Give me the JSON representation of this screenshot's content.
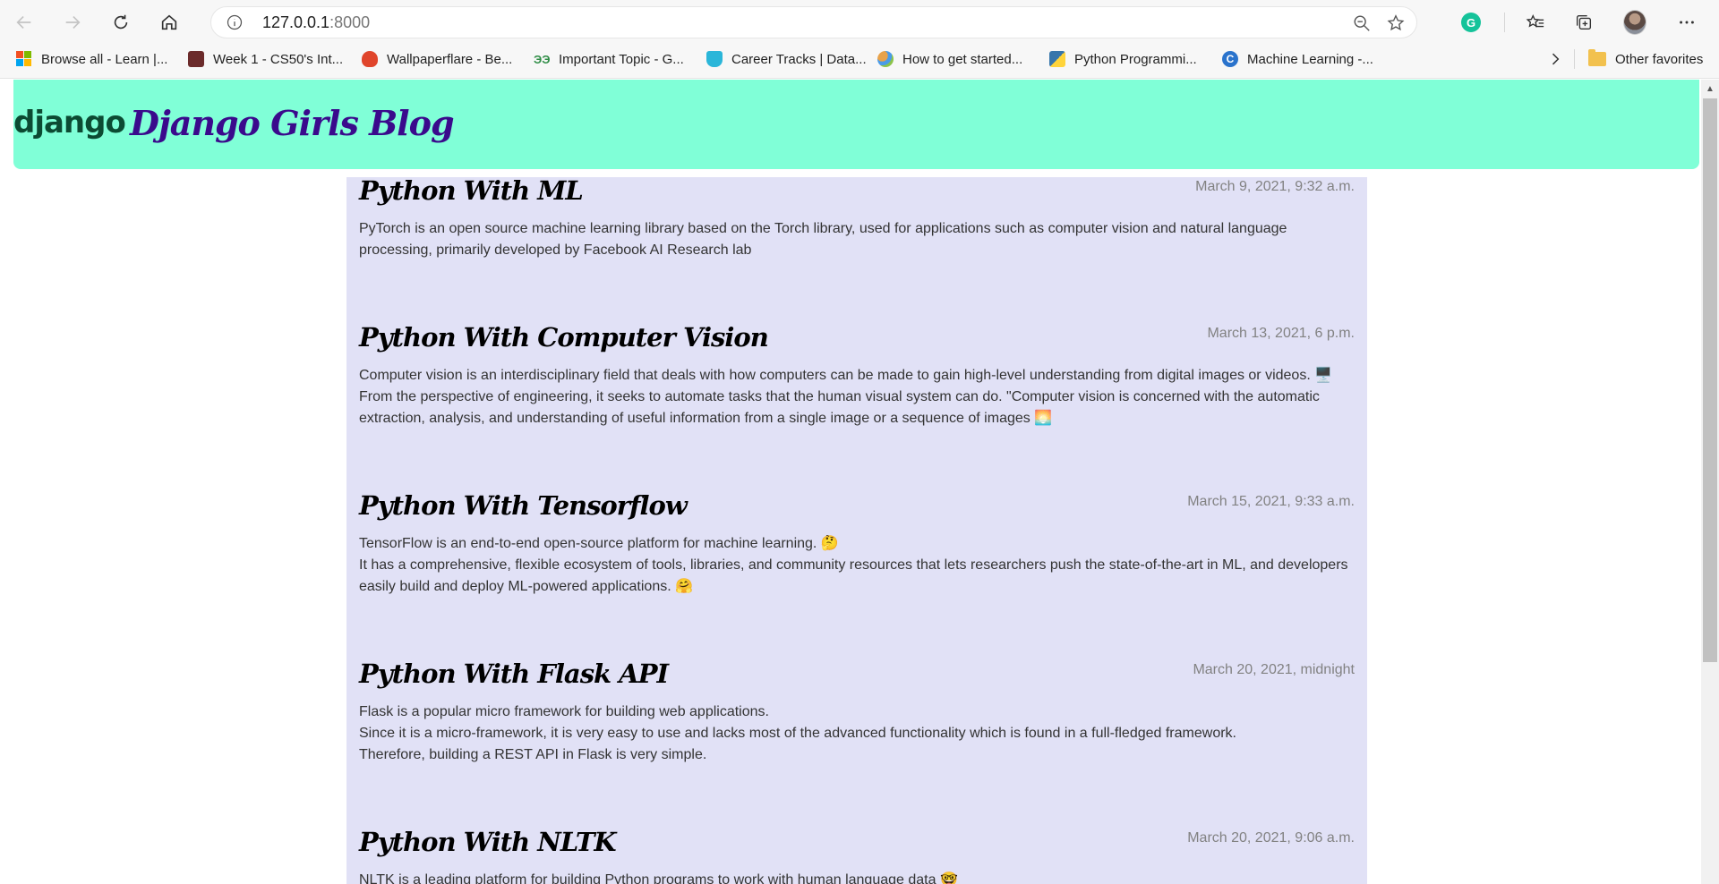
{
  "browser": {
    "url_host": "127.0.0.1",
    "url_port": ":8000",
    "bookmarks": [
      {
        "label": "Browse all - Learn |...",
        "icon": "microsoft-icon"
      },
      {
        "label": "Week 1 - CS50's Int...",
        "icon": "harvard-icon",
        "color": "#6b2b2b"
      },
      {
        "label": "Wallpaperflare - Be...",
        "icon": "flame-icon",
        "color": "#e0452b"
      },
      {
        "label": "Important Topic - G...",
        "icon": "gfg-icon",
        "color": "#2f8d46"
      },
      {
        "label": "Career Tracks | Data...",
        "icon": "datacamp-icon",
        "color": "#03ef62"
      },
      {
        "label": "How to get started...",
        "icon": "kaggle-icon",
        "color": "#e8a24a"
      },
      {
        "label": "Python Programmi...",
        "icon": "python-icon",
        "color": "#3776ab"
      },
      {
        "label": "Machine Learning -...",
        "icon": "coursera-icon",
        "color": "#2a73cc"
      }
    ],
    "other_favorites": "Other favorites",
    "grammarly_letter": "G"
  },
  "header": {
    "logo": "django",
    "title": "Django Girls Blog"
  },
  "posts": [
    {
      "title": "Python With ML",
      "date": "March 9, 2021, 9:32 a.m.",
      "lines": [
        "PyTorch is an open source machine learning library based on the Torch library, used for applications such as computer vision and natural language processing, primarily developed by Facebook AI Research lab"
      ]
    },
    {
      "title": "Python With Computer Vision",
      "date": "March 13, 2021, 6 p.m.",
      "lines": [
        "Computer vision is an interdisciplinary field that deals with how computers can be made to gain high-level understanding from digital images or videos. 🖥️ From the perspective of engineering, it seeks to automate tasks that the human visual system can do. \"Computer vision is concerned with the automatic extraction, analysis, and understanding of useful information from a single image or a sequence of images 🌅"
      ]
    },
    {
      "title": "Python With Tensorflow",
      "date": "March 15, 2021, 9:33 a.m.",
      "lines": [
        "TensorFlow is an end-to-end open-source platform for machine learning. 🤔",
        "It has a comprehensive, flexible ecosystem of tools, libraries, and community resources that lets researchers push the state-of-the-art in ML, and developers easily build and deploy ML-powered applications. 🤗"
      ]
    },
    {
      "title": "Python With Flask API",
      "date": "March 20, 2021, midnight",
      "lines": [
        "Flask is a popular micro framework for building web applications.",
        "Since it is a micro-framework, it is very easy to use and lacks most of the advanced functionality which is found in a full-fledged framework.",
        "Therefore, building a REST API in Flask is very simple."
      ]
    },
    {
      "title": "Python With NLTK",
      "date": "March 20, 2021, 9:06 a.m.",
      "lines": [
        "NLTK is a leading platform for building Python programs to work with human language data 🤓"
      ]
    }
  ]
}
